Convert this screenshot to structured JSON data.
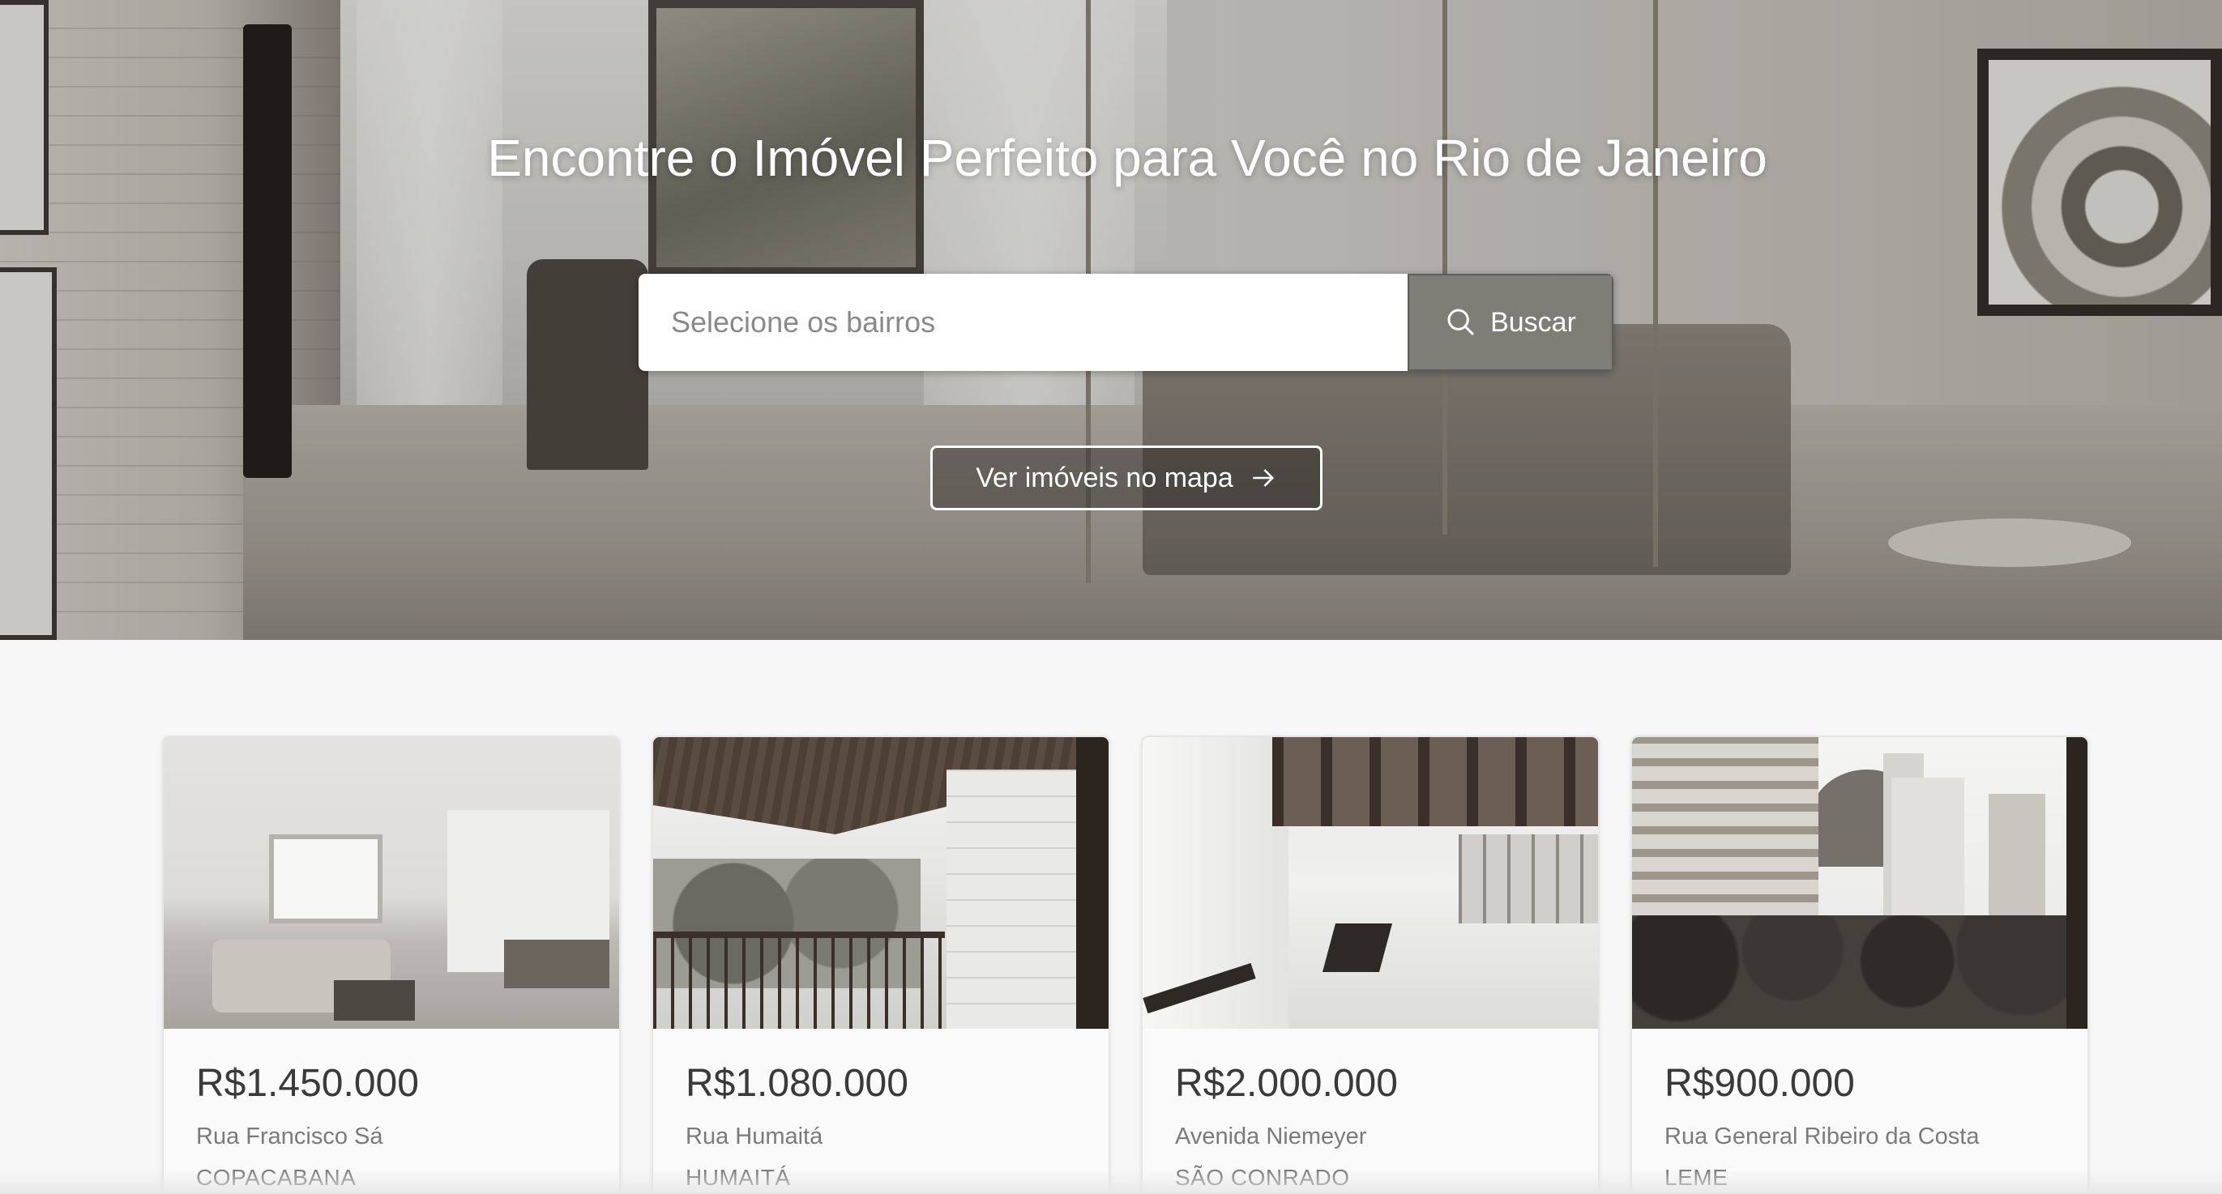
{
  "hero": {
    "title": "Encontre o Imóvel Perfeito para Você no Rio de Janeiro",
    "search": {
      "placeholder": "Selecione os bairros",
      "button_label": "Buscar",
      "button_icon": "search-icon"
    },
    "map_button": {
      "label": "Ver imóveis no mapa",
      "icon": "arrow-right-icon"
    }
  },
  "listings": [
    {
      "price": "R$1.450.000",
      "street": "Rua Francisco Sá",
      "neighborhood": "COPACABANA"
    },
    {
      "price": "R$1.080.000",
      "street": "Rua Humaitá",
      "neighborhood": "HUMAITÁ"
    },
    {
      "price": "R$2.000.000",
      "street": "Avenida Niemeyer",
      "neighborhood": "SÃO CONRADO"
    },
    {
      "price": "R$900.000",
      "street": "Rua General Ribeiro da Costa",
      "neighborhood": "LEME"
    }
  ],
  "colors": {
    "search_button_bg": "#7e7d76",
    "text_primary": "#3a3a3a",
    "text_secondary": "#7b7b7b",
    "page_bg": "#f7f7f7"
  }
}
